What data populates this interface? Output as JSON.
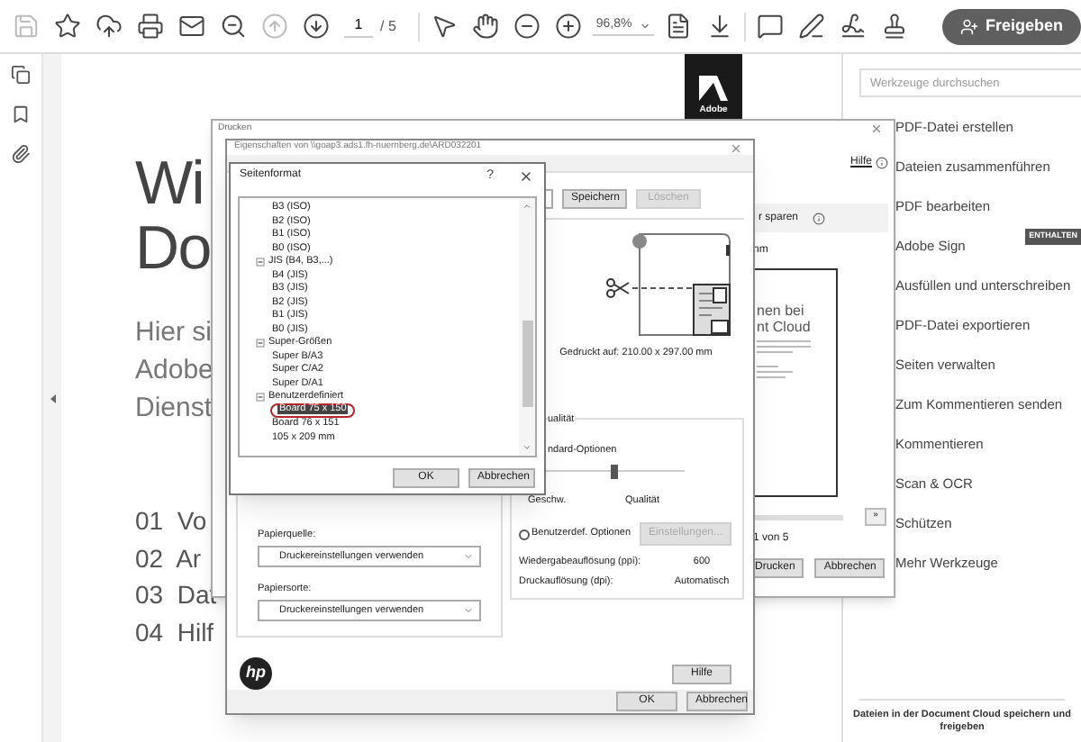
{
  "toolbar": {
    "page_field": {
      "value": "1"
    },
    "page_count": "/ 5",
    "zoom": "96,8%",
    "share_button": "Freigeben"
  },
  "document": {
    "logo": "Adobe",
    "heading_lines": [
      "Wi",
      "Do"
    ],
    "intro_lines": [
      "Hier si",
      "Adobe",
      "Dienst"
    ],
    "contents": [
      "01  Vo",
      "02  Ar",
      "03  Dat",
      "04  Hilf"
    ]
  },
  "tools_pane": {
    "search": {
      "placeholder": "Werkzeuge durchsuchen"
    },
    "tools": [
      {
        "label": "PDF-Datei erstellen"
      },
      {
        "label": "Dateien zusammenführen"
      },
      {
        "label": "PDF bearbeiten"
      },
      {
        "label": "Adobe Sign",
        "badge": "ENTHALTEN"
      },
      {
        "label": "Ausfüllen und unterschreiben"
      },
      {
        "label": "PDF-Datei exportieren"
      },
      {
        "label": "Seiten verwalten"
      },
      {
        "label": "Zum Kommentieren senden"
      },
      {
        "label": "Kommentieren"
      },
      {
        "label": "Scan & OCR"
      },
      {
        "label": "Schützen"
      },
      {
        "label": "Mehr Werkzeuge"
      }
    ],
    "footer": "Dateien in der Document Cloud speichern und freigeben"
  },
  "print_dialog": {
    "title": "Drucken",
    "help": "Hilfe",
    "option_text": "r sparen",
    "section": "nm",
    "preview_lines": [
      "nen bei",
      "nt Cloud"
    ],
    "page_info": "1 von 5",
    "next_button": "»",
    "buttons": [
      "Drucken",
      "Abbrechen"
    ]
  },
  "properties_dialog": {
    "title": "Eigenschaften von \\\\goap3.ads1.fh-nuernberg.de\\ARD032201",
    "preset_buttons": [
      {
        "label": "Speichern",
        "disabled": false
      },
      {
        "label": "Löschen",
        "disabled": true
      }
    ],
    "printed_on": "Gedruckt auf: 210.00 x 297.00 mm",
    "paper_source": {
      "label": "Papierquelle:",
      "value": "Druckereinstellungen verwenden"
    },
    "paper_type": {
      "label": "Papiersorte:",
      "value": "Druckereinstellungen verwenden"
    },
    "quality": {
      "legend": "ualität",
      "standard": "ndard-Optionen",
      "level": 0.55,
      "left": "Geschw.",
      "right": "Qualität",
      "custom": {
        "label": "Benutzerdef. Optionen",
        "selected": false
      },
      "settings_button": {
        "label": "Einstellungen...",
        "disabled": true
      },
      "rows": [
        {
          "label": "Wiedergabeauflösung (ppi):",
          "value": "600"
        },
        {
          "label": "Druckauflösung (dpi):",
          "value": "Automatisch"
        }
      ]
    },
    "brand_logo": "hp",
    "help_button": "Hilfe",
    "buttons": [
      "OK",
      "Abbrechen"
    ]
  },
  "page_format_dialog": {
    "title": "Seitenformat",
    "help": "?",
    "tree": [
      {
        "children": [
          {
            "label": "B3 (ISO)",
            "selected": false
          },
          {
            "label": "B2 (ISO)",
            "selected": false
          },
          {
            "label": "B1 (ISO)",
            "selected": false
          },
          {
            "label": "B0 (ISO)",
            "selected": false
          }
        ]
      },
      {
        "label": "JIS (B4, B3,...)",
        "expanded": true,
        "children": [
          {
            "label": "B4 (JIS)",
            "selected": false
          },
          {
            "label": "B3 (JIS)",
            "selected": false
          },
          {
            "label": "B2 (JIS)",
            "selected": false
          },
          {
            "label": "B1 (JIS)",
            "selected": false
          },
          {
            "label": "B0 (JIS)",
            "selected": false
          }
        ]
      },
      {
        "label": "Super-Größen",
        "expanded": true,
        "children": [
          {
            "label": "Super B/A3",
            "selected": false
          },
          {
            "label": "Super C/A2",
            "selected": false
          },
          {
            "label": "Super D/A1",
            "selected": false
          }
        ]
      },
      {
        "label": "Benutzerdefiniert",
        "expanded": true,
        "children": [
          {
            "label": "Board 75 x 150",
            "selected": true
          },
          {
            "label": "Board 76 x 151",
            "selected": false
          },
          {
            "label": "105 x 209 mm",
            "selected": false
          }
        ]
      }
    ],
    "buttons": [
      "OK",
      "Abbrechen"
    ]
  }
}
